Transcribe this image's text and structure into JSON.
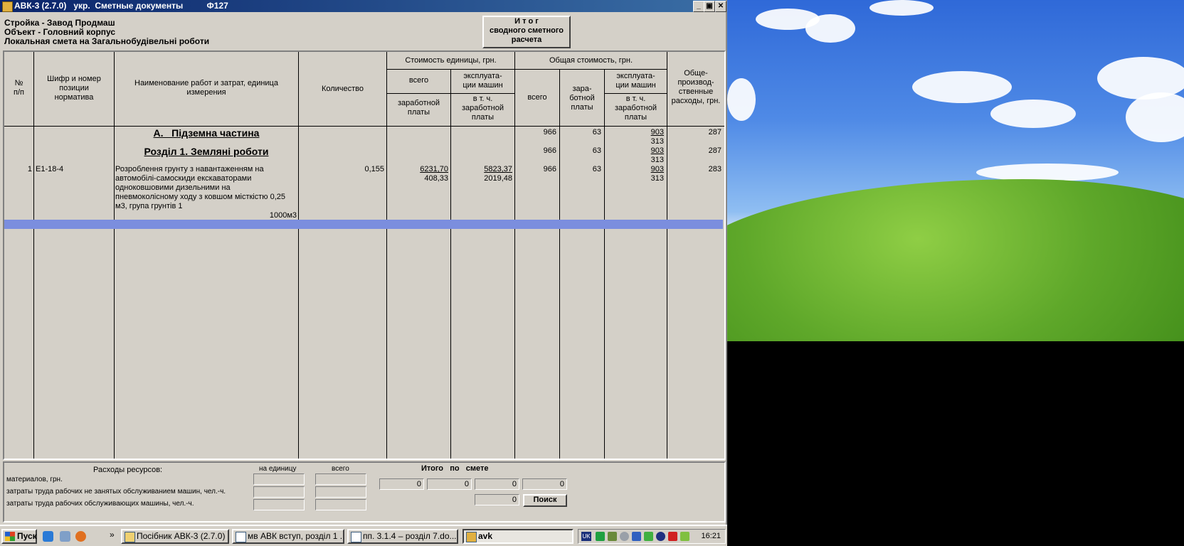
{
  "window": {
    "title": "АВК-3 (2.7.0)   укр.  Сметные документы          Ф127",
    "min": "_",
    "max": "▣",
    "close": "✕"
  },
  "header": {
    "line1": "Стройка - Завод Продмаш",
    "line2": "Объект - Головний корпус",
    "line3": "Локальная смета на Загальнобудівельні роботи",
    "summary_button": [
      "И т о г",
      "сводного сметного",
      "расчета"
    ]
  },
  "table": {
    "headers": {
      "num": [
        "№",
        "п/п"
      ],
      "code": [
        "Шифр и номер",
        "позиции",
        "норматива"
      ],
      "name": [
        "Наименование работ и затрат, единица",
        "измерения"
      ],
      "qty": "Количество",
      "unit_cost": "Стоимость единицы, грн.",
      "unit_total": "всего",
      "unit_machine": [
        "эксплуата-",
        "ции машин"
      ],
      "unit_wage": [
        "заработной",
        "платы"
      ],
      "unit_machine_wage": [
        "в т. ч.",
        "заработной",
        "платы"
      ],
      "total_cost": "Общая стоимость, грн.",
      "total_all": "всего",
      "total_wage": [
        "зара-",
        "ботной",
        "платы"
      ],
      "total_machine": [
        "эксплуата-",
        "ции машин"
      ],
      "total_machine_wage": [
        "в т. ч.",
        "заработной",
        "платы"
      ],
      "overhead": [
        "Обще-",
        "производ-",
        "ственные",
        "расходы, грн."
      ]
    },
    "rows": [
      {
        "section": "А.   Підземна частина",
        "total": "966",
        "wage": "63",
        "machine": "903",
        "machine_wage": "313",
        "overhead": "287"
      },
      {
        "section": "Розділ 1. Земляні роботи",
        "total": "966",
        "wage": "63",
        "machine": "903",
        "machine_wage": "313",
        "overhead": "287"
      },
      {
        "num": "1",
        "code": "Е1-18-4",
        "name": [
          "Розроблення грунту з навантаженням на",
          "автомобілі-самоскиди екскаваторами",
          "одноковшовими дизельними на",
          "пневмоколісному ходу з ковшом місткістю 0,25",
          "м3, група грунтів 1"
        ],
        "unit": "1000м3",
        "qty": "0,155",
        "unit_total": "6231,70",
        "unit_wage": "408,33",
        "unit_machine": "5823,37",
        "unit_machine_wage": "2019,48",
        "total": "966",
        "wage": "63",
        "machine": "903",
        "machine_wage": "313",
        "overhead": "283"
      }
    ]
  },
  "resources": {
    "title": "Расходы ресурсов:",
    "col_unit": "на единицу",
    "col_total": "всего",
    "rows": [
      "материалов, грн.",
      "затраты труда рабочих не занятых обслуживанием машин, чел.-ч.",
      "затраты труда рабочих обслуживающих машины, чел.-ч."
    ],
    "totals_label": "Итого   по   смете",
    "totals": [
      "0",
      "0",
      "0",
      "0"
    ],
    "last_value": "0",
    "search_button": "Поиск"
  },
  "taskbar": {
    "start": "Пуск",
    "tasks": [
      {
        "label": "Посібник АВК-3 (2.7.0)",
        "active": false
      },
      {
        "label": "мв АВК вступ, розділ 1 ...",
        "active": false
      },
      {
        "label": "пп. 3.1.4 – розділ 7.do...",
        "active": false
      },
      {
        "label": "avk",
        "active": true
      }
    ],
    "language": "UK",
    "clock": "16:21",
    "overflow": "»"
  }
}
